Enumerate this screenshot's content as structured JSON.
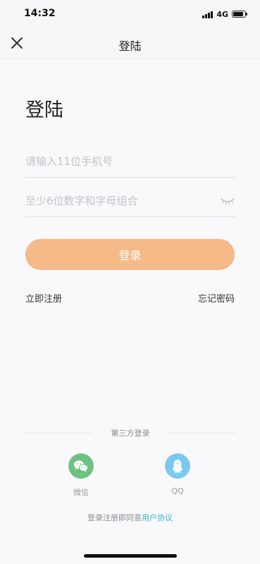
{
  "status_bar": {
    "time": "14:32",
    "network": "4G"
  },
  "nav": {
    "title": "登陆",
    "close_icon": "close-icon"
  },
  "page": {
    "heading": "登陆"
  },
  "form": {
    "phone_placeholder": "请输入11位手机号",
    "password_placeholder": "至少6位数字和字母组合",
    "login_label": "登录",
    "register_label": "立即注册",
    "forgot_label": "忘记密码"
  },
  "third_party": {
    "title": "第三方登录",
    "options": [
      {
        "label": "微信",
        "icon": "wechat-icon",
        "color": "#6cc381"
      },
      {
        "label": "QQ",
        "icon": "qq-icon",
        "color": "#7cc8f0"
      }
    ]
  },
  "agreement": {
    "prefix": "登录注册即同意",
    "link": "用户协议"
  },
  "colors": {
    "accent": "#f6b988",
    "link": "#3ab3c9"
  }
}
